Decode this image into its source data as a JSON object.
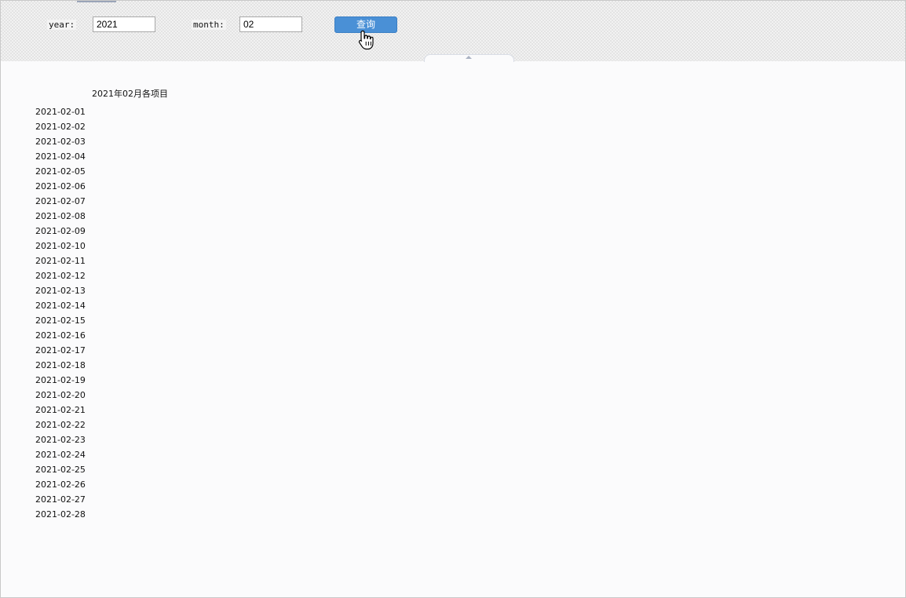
{
  "query_bar": {
    "year_label": "year:",
    "year_value": "2021",
    "month_label": "month:",
    "month_value": "02",
    "query_button_label": "查询"
  },
  "report": {
    "title": "2021年02月各项目",
    "dates": [
      "2021-02-01",
      "2021-02-02",
      "2021-02-03",
      "2021-02-04",
      "2021-02-05",
      "2021-02-06",
      "2021-02-07",
      "2021-02-08",
      "2021-02-09",
      "2021-02-10",
      "2021-02-11",
      "2021-02-12",
      "2021-02-13",
      "2021-02-14",
      "2021-02-15",
      "2021-02-16",
      "2021-02-17",
      "2021-02-18",
      "2021-02-19",
      "2021-02-20",
      "2021-02-21",
      "2021-02-22",
      "2021-02-23",
      "2021-02-24",
      "2021-02-25",
      "2021-02-26",
      "2021-02-27",
      "2021-02-28"
    ]
  },
  "icons": {
    "cursor": "hand-pointer-icon",
    "collapse": "chevron-up-icon"
  },
  "colors": {
    "query_button": "#4a90d6",
    "query_button_text": "#ffffff"
  }
}
